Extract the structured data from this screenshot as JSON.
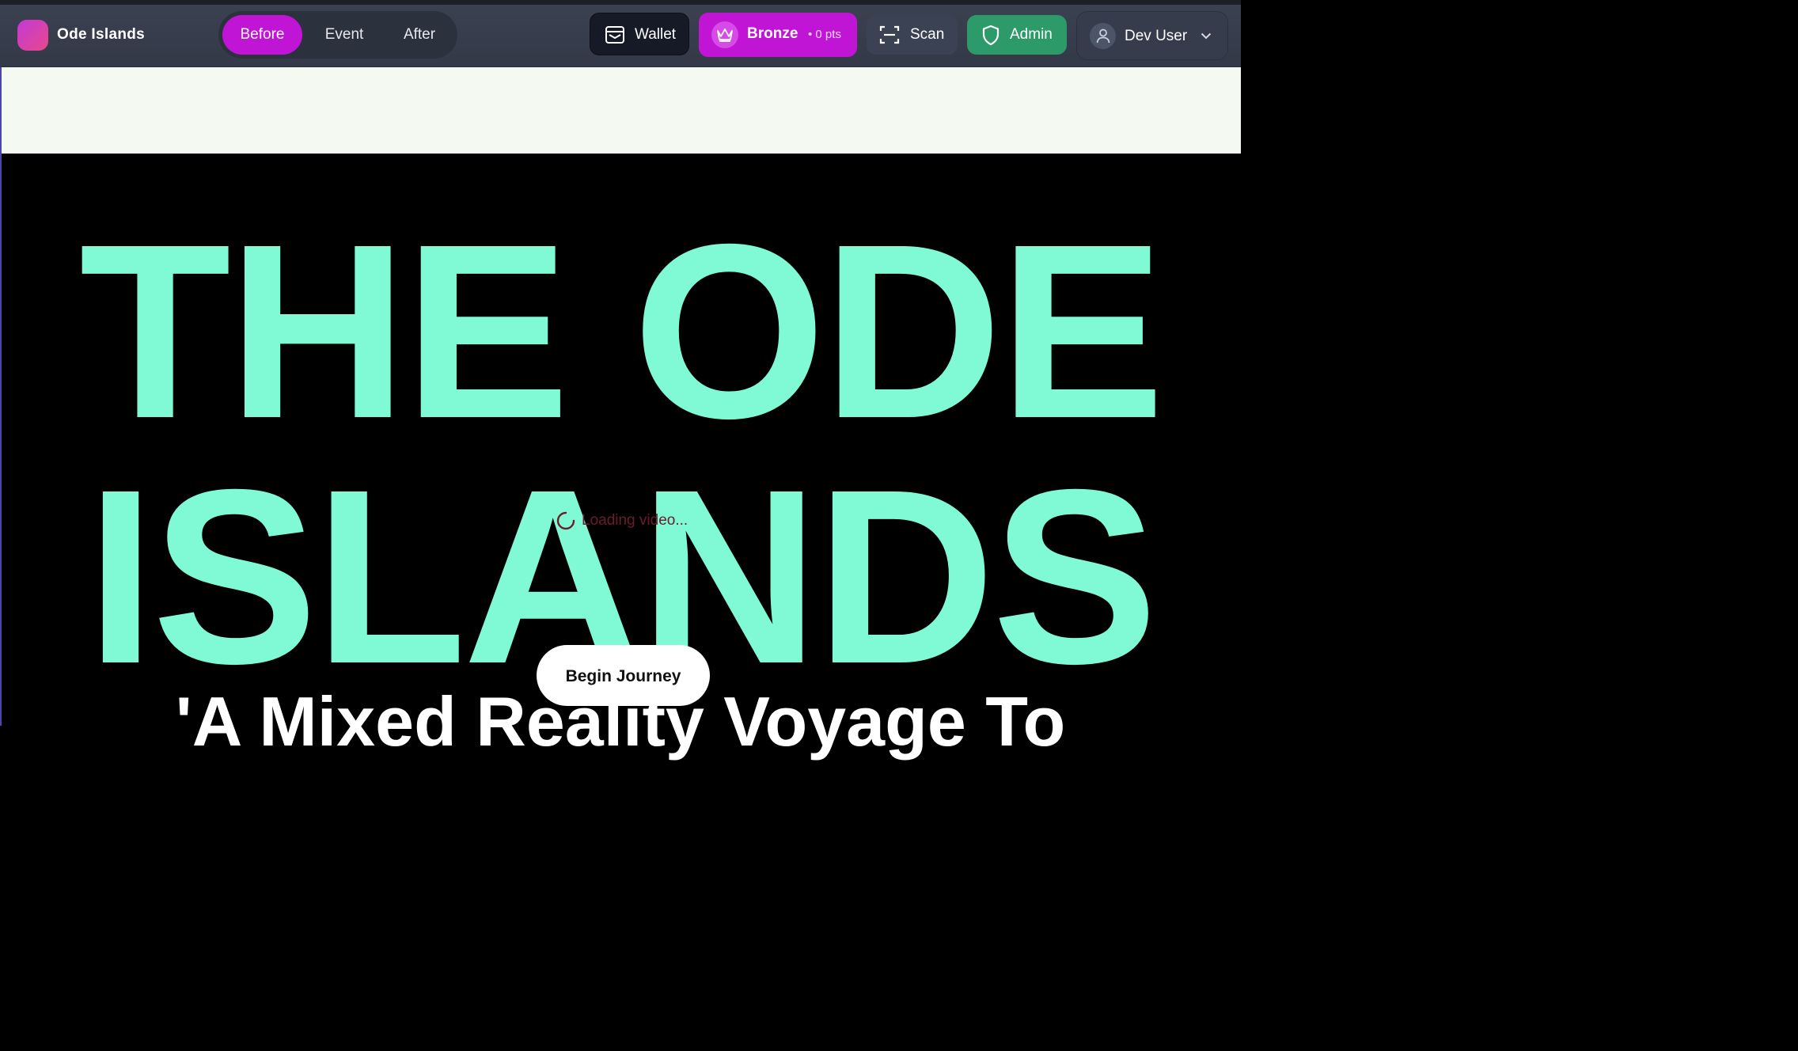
{
  "app": {
    "brand": "Ode Islands"
  },
  "phase_tabs": [
    {
      "label": "Before",
      "active": true
    },
    {
      "label": "Event",
      "active": false
    },
    {
      "label": "After",
      "active": false
    }
  ],
  "toolbar": {
    "wallet_label": "Wallet",
    "tier_label": "Bronze",
    "points_label": "• 0 pts",
    "scan_label": "Scan",
    "admin_label": "Admin",
    "user_label": "Dev User"
  },
  "hero": {
    "title_line1": "THE ODE",
    "title_line2": "ISLANDS",
    "loading_text": "Loading video...",
    "cta_label": "Begin Journey",
    "subtitle": "'A Mixed Reality Voyage To"
  },
  "colors": {
    "accent_magenta": "#c115d6",
    "hero_mint": "#7ffad5",
    "admin_green": "#2d9a6a",
    "header_bg": "#3b4150"
  },
  "icons": [
    "wallet-icon",
    "crown-icon",
    "scan-icon",
    "shield-icon",
    "user-icon",
    "chevron-down-icon",
    "spinner-icon"
  ]
}
